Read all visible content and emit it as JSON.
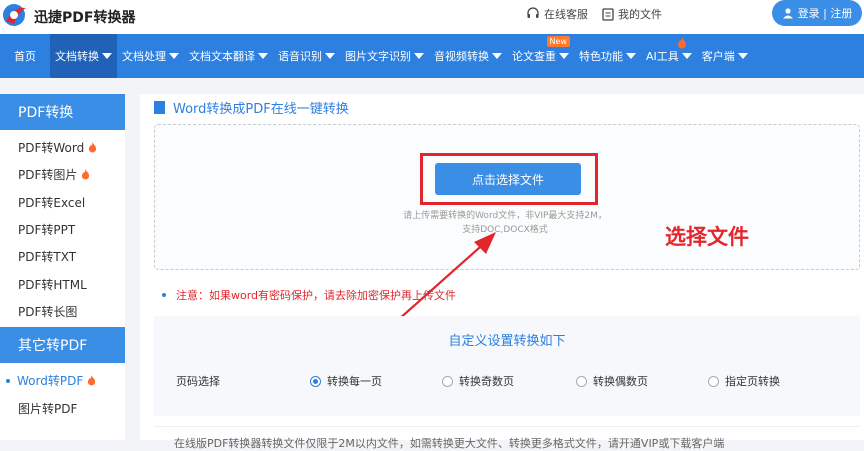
{
  "header": {
    "logo_text": "迅捷PDF转换器",
    "service_label": "在线客服",
    "myfiles_label": "我的文件",
    "login_label": "登录 | 注册"
  },
  "nav": {
    "items": [
      {
        "label": "首页",
        "caret": false
      },
      {
        "label": "文档转换",
        "caret": true,
        "active": true
      },
      {
        "label": "文档处理",
        "caret": true
      },
      {
        "label": "文档文本翻译",
        "caret": true
      },
      {
        "label": "语音识别",
        "caret": true
      },
      {
        "label": "图片文字识别",
        "caret": true
      },
      {
        "label": "音视频转换",
        "caret": true
      },
      {
        "label": "论文查重",
        "caret": true,
        "badge": "New"
      },
      {
        "label": "特色功能",
        "caret": true
      },
      {
        "label": "AI工具",
        "caret": true,
        "hot": true
      },
      {
        "label": "客户端",
        "caret": true
      }
    ]
  },
  "sidebar": {
    "group1_title": "PDF转换",
    "group1_items": [
      {
        "label": "PDF转Word",
        "hot": true
      },
      {
        "label": "PDF转图片",
        "hot": true
      },
      {
        "label": "PDF转Excel"
      },
      {
        "label": "PDF转PPT"
      },
      {
        "label": "PDF转TXT"
      },
      {
        "label": "PDF转HTML"
      },
      {
        "label": "PDF转长图"
      }
    ],
    "group2_title": "其它转PDF",
    "group2_items": [
      {
        "label": "Word转PDF",
        "hot": true,
        "active": true
      },
      {
        "label": "图片转PDF"
      }
    ]
  },
  "main": {
    "title": "Word转换成PDF在线一键转换",
    "select_button": "点击选择文件",
    "hint_line1": "请上传需要转换的Word文件，非VIP最大支持2M，",
    "hint_line2": "支持DOC,DOCX格式",
    "annotation": "选择文件",
    "notice": "注意：如果word有密码保护，请去除加密保护再上传文件",
    "custom_title": "自定义设置转换如下",
    "page_select_label": "页码选择",
    "page_options": [
      "转换每一页",
      "转换奇数页",
      "转换偶数页",
      "指定页转换"
    ],
    "selected_option": 0,
    "bottom_text": "在线版PDF转换器转换文件仅限于2M以内文件，如需转换更大文件、转换更多格式文件，请开通VIP或下载客户端"
  },
  "colors": {
    "primary": "#2d7fe0",
    "accent_red": "#e3262c",
    "hot": "#ff6a2b"
  }
}
